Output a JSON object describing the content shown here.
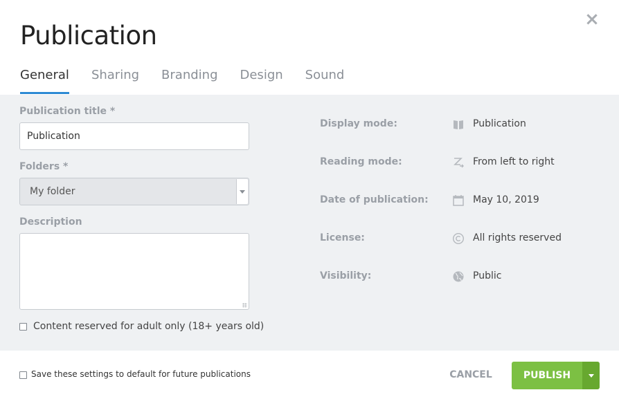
{
  "dialog": {
    "title": "Publication",
    "close_icon": "close-icon"
  },
  "tabs": [
    {
      "label": "General",
      "active": true
    },
    {
      "label": "Sharing",
      "active": false
    },
    {
      "label": "Branding",
      "active": false
    },
    {
      "label": "Design",
      "active": false
    },
    {
      "label": "Sound",
      "active": false
    }
  ],
  "form": {
    "title_label": "Publication title",
    "required_mark": "*",
    "title_value": "Publication",
    "folders_label": "Folders",
    "folders_value": "My folder",
    "description_label": "Description",
    "description_value": "",
    "adult_label": "Content reserved for adult only (18+ years old)",
    "adult_checked": false
  },
  "meta": [
    {
      "label": "Display mode:",
      "icon": "book-icon",
      "value": "Publication"
    },
    {
      "label": "Reading mode:",
      "icon": "reading-direction-icon",
      "value": "From left to right"
    },
    {
      "label": "Date of publication:",
      "icon": "calendar-icon",
      "value": "May 10, 2019"
    },
    {
      "label": "License:",
      "icon": "copyright-icon",
      "value": "All rights reserved"
    },
    {
      "label": "Visibility:",
      "icon": "globe-icon",
      "value": "Public"
    }
  ],
  "footer": {
    "save_default_label": "Save these settings to default for future publications",
    "save_default_checked": false,
    "cancel_label": "CANCEL",
    "publish_label": "PUBLISH"
  },
  "colors": {
    "accent": "#2d8ad4",
    "publish": "#7cc043",
    "panel": "#eff1f3"
  }
}
